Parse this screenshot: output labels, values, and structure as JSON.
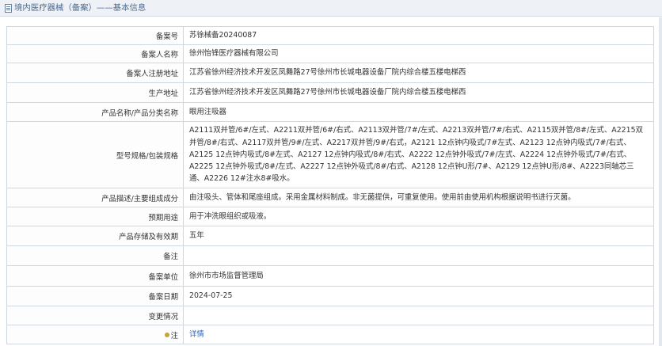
{
  "page": {
    "title": "境内医疗器械（备案）——基本信息"
  },
  "rows": [
    {
      "label": "备案号",
      "value": "苏徐械备20240087"
    },
    {
      "label": "备案人名称",
      "value": "徐州怡锋医疗器械有限公司"
    },
    {
      "label": "备案人注册地址",
      "value": "江苏省徐州经济技术开发区凤舞路27号徐州市长城电器设备厂院内综合楼五楼电梯西"
    },
    {
      "label": "生产地址",
      "value": "江苏省徐州经济技术开发区凤舞路27号徐州市长城电器设备厂院内综合楼五楼电梯西"
    },
    {
      "label": "产品名称/产品分类名称",
      "value": "眼用注吸器"
    },
    {
      "label": "型号规格/包装规格",
      "value": "A2111双并管/6#/左式、A2211双并管/6#/右式、A2113双并管/7#/左式、A2213双并管/7#/右式、A2115双并管/8#/左式、A2215双并管/8#/右式、A2117双并管/9#/左式、A2217双并管/9#/右式，A2121 12点钟内吸式/7#左式、A2123 12点钟内吸式/7#/右式、A2125 12点钟内吸式/8#左式、A2127 12点钟内吸式/8#/右式、A2222 12点钟外吸式/7#/左式、A2224 12点钟外吸式/7#/右式、A2225 12点钟外吸式/8#/左式、A2227 12点钟外吸式/8#/右式、A2128 12点钟U形/7#、A2129 12点钟U形/8#、A2223同轴芯三通、A2226 12#注水8#吸水。"
    },
    {
      "label": "产品描述/主要组成成分",
      "value": "由注吸头、管体和尾座组成。采用金属材料制成。非无菌提供，可重复使用。使用前由使用机构根据说明书进行灭菌。"
    },
    {
      "label": "预期用途",
      "value": "用于冲洗眼组织或吸液。"
    },
    {
      "label": "产品存储及有效期",
      "value": "五年"
    },
    {
      "label": "备注",
      "value": ""
    },
    {
      "label": "备案单位",
      "value": "徐州市市场监督管理局"
    },
    {
      "label": "备案日期",
      "value": "2024-07-25"
    },
    {
      "label": "变更情况",
      "value": ""
    },
    {
      "label": "注",
      "value": "详情"
    }
  ]
}
